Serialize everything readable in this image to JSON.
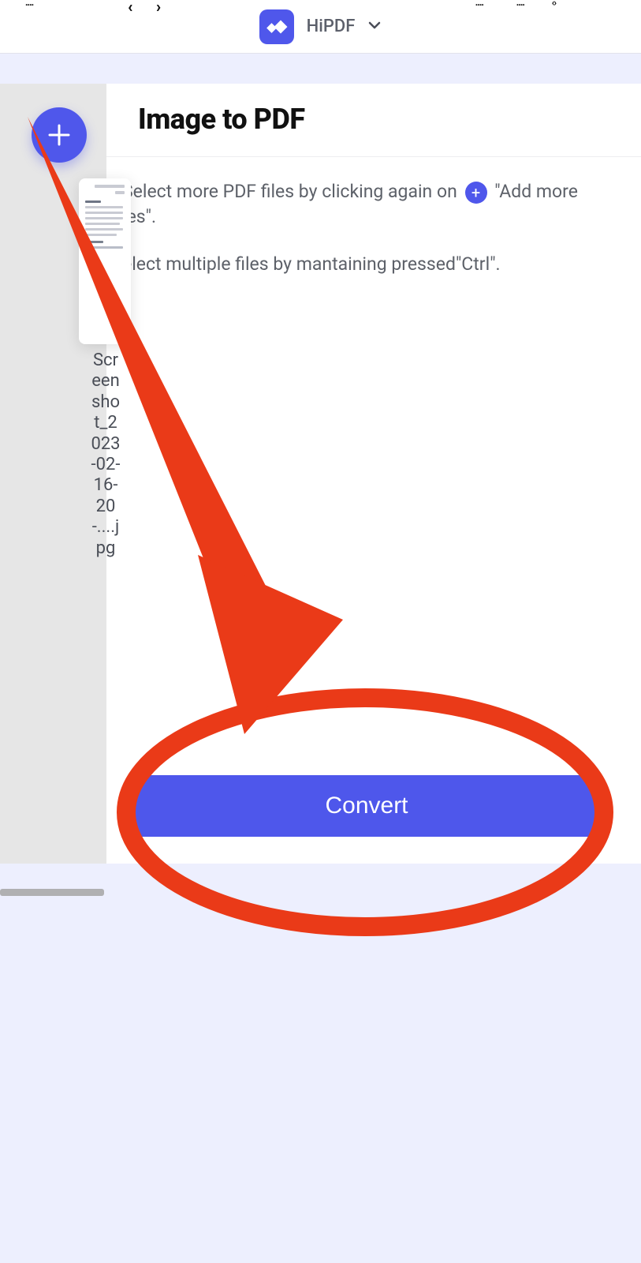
{
  "brand": {
    "name": "HiPDF"
  },
  "page": {
    "title": "Image to PDF"
  },
  "instructions": {
    "line1_prefix": "Select more PDF files by clicking again on",
    "line1_suffix": "\"Add more  les\".",
    "line2": "elect multiple files by mantaining pressed\"Ctrl\"."
  },
  "file": {
    "name": "Screenshot_2023-02-16-20-....jpg"
  },
  "actions": {
    "convert": "Convert"
  },
  "colors": {
    "accent": "#4f57eb",
    "annotation": "#ea3a18"
  }
}
